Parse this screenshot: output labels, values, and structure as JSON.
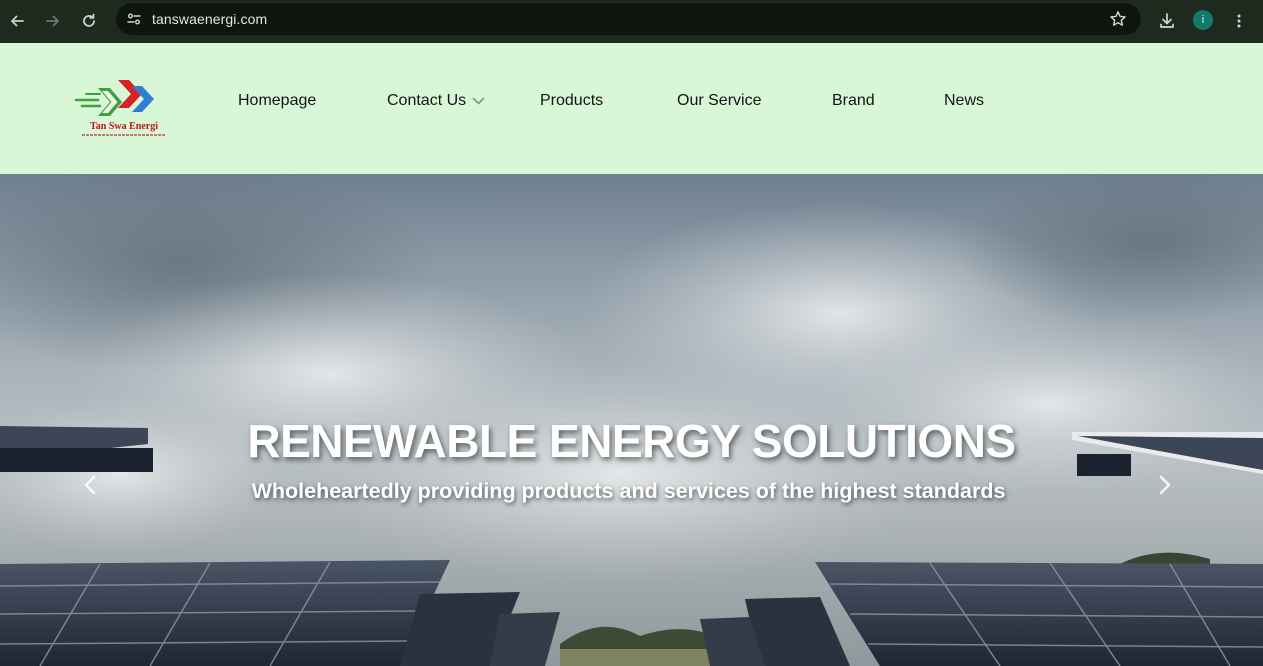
{
  "browser": {
    "url": "tanswaenergi.com",
    "profile_initial": "i"
  },
  "logo": {
    "name": "Tan Swa Energi",
    "colors": {
      "green": "#3ea13f",
      "red": "#d6232a",
      "blue": "#2f7fd1"
    }
  },
  "nav": {
    "items": [
      {
        "label": "Homepage"
      },
      {
        "label": "Contact Us"
      },
      {
        "label": "Products"
      },
      {
        "label": "Our Service"
      },
      {
        "label": "Brand"
      },
      {
        "label": "News"
      }
    ]
  },
  "hero": {
    "title": "RENEWABLE ENERGY SOLUTIONS",
    "subtitle": "Wholeheartedly providing products and services of the highest standards"
  },
  "colors": {
    "chrome_bg": "#1e2a1e",
    "header_bg": "#d8f7d7",
    "hero_text": "#ffffff"
  }
}
